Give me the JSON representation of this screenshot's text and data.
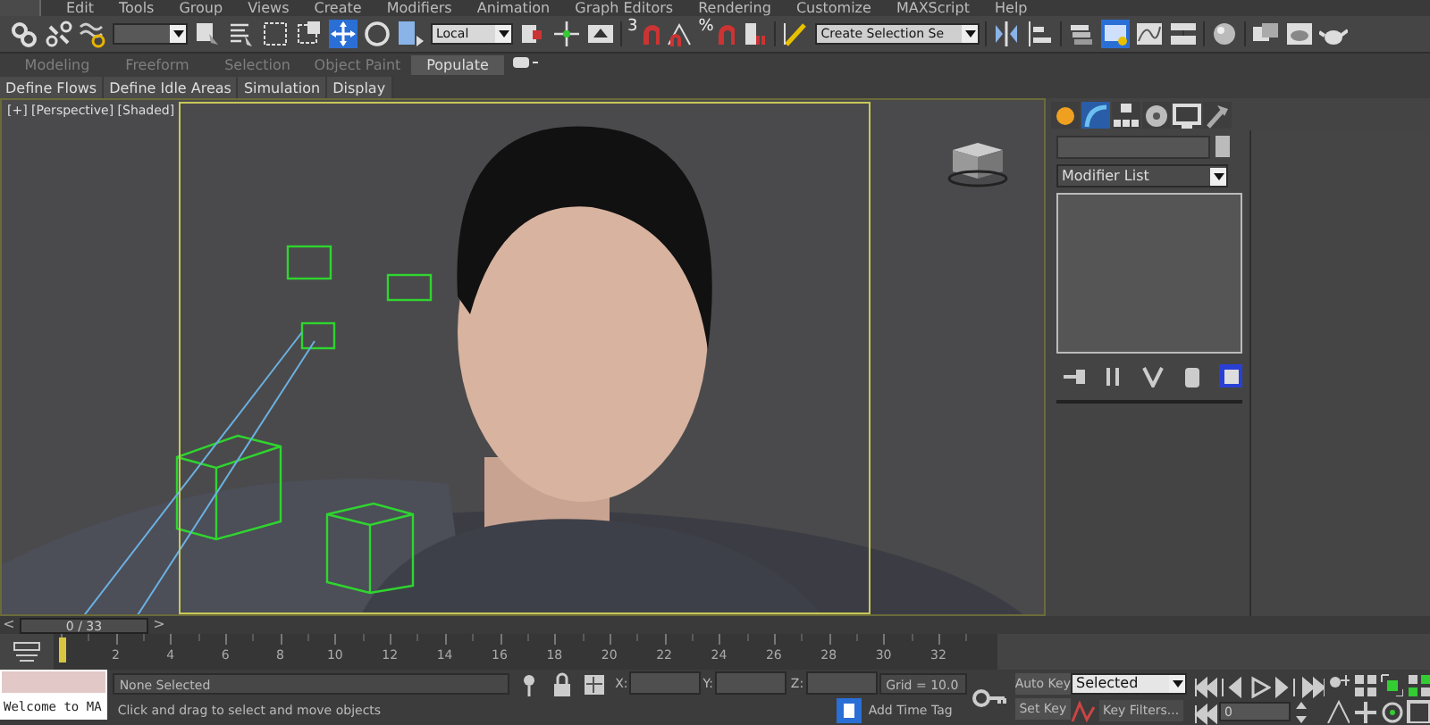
{
  "menu": [
    "Edit",
    "Tools",
    "Group",
    "Views",
    "Create",
    "Modifiers",
    "Animation",
    "Graph Editors",
    "Rendering",
    "Customize",
    "MAXScript",
    "Help"
  ],
  "toolbar": {
    "reference_coordinates": "Local",
    "snap_toggle": "3",
    "percent_snap": "%",
    "named_selection_set": "Create Selection Se"
  },
  "ribbon": {
    "tabs": [
      {
        "label": "Modeling",
        "selected": false
      },
      {
        "label": "Freeform",
        "selected": false
      },
      {
        "label": "Selection",
        "selected": false
      },
      {
        "label": "Object Paint",
        "selected": false
      },
      {
        "label": "Populate",
        "selected": true
      }
    ],
    "panel_items": [
      "Define Flows",
      "Define Idle Areas",
      "Simulation",
      "Display"
    ]
  },
  "viewport": {
    "label": "[+] [Perspective] [Shaded]"
  },
  "command_panel": {
    "tabs": [
      {
        "kind": "create",
        "selected": false
      },
      {
        "kind": "modify",
        "selected": true
      },
      {
        "kind": "hierarchy",
        "selected": false
      },
      {
        "kind": "motion",
        "selected": false
      },
      {
        "kind": "display",
        "selected": false
      },
      {
        "kind": "utilities",
        "selected": false
      }
    ],
    "modifier_list": "Modifier List"
  },
  "time_slider": {
    "previous": "<",
    "frame": "0 / 33",
    "next": ">"
  },
  "track_bar": {
    "frame_labels": [
      "2",
      "4",
      "6",
      "8",
      "10",
      "12",
      "14",
      "16",
      "18",
      "20",
      "22",
      "24",
      "26",
      "28",
      "30",
      "32"
    ]
  },
  "status_bar": {
    "maxscript_output": "Welcome to MA",
    "selection": "None Selected",
    "prompt": "Click and drag to select and move objects",
    "x_label": "X:",
    "y_label": "Y:",
    "z_label": "Z:",
    "grid": "Grid = 10.0",
    "add_time_tag": "Add Time Tag"
  },
  "animation_controls": {
    "auto_key": "Auto Key",
    "set_key": "Set Key",
    "key_mode": "Selected",
    "key_filters": "Key Filters...",
    "current_frame": "0"
  }
}
